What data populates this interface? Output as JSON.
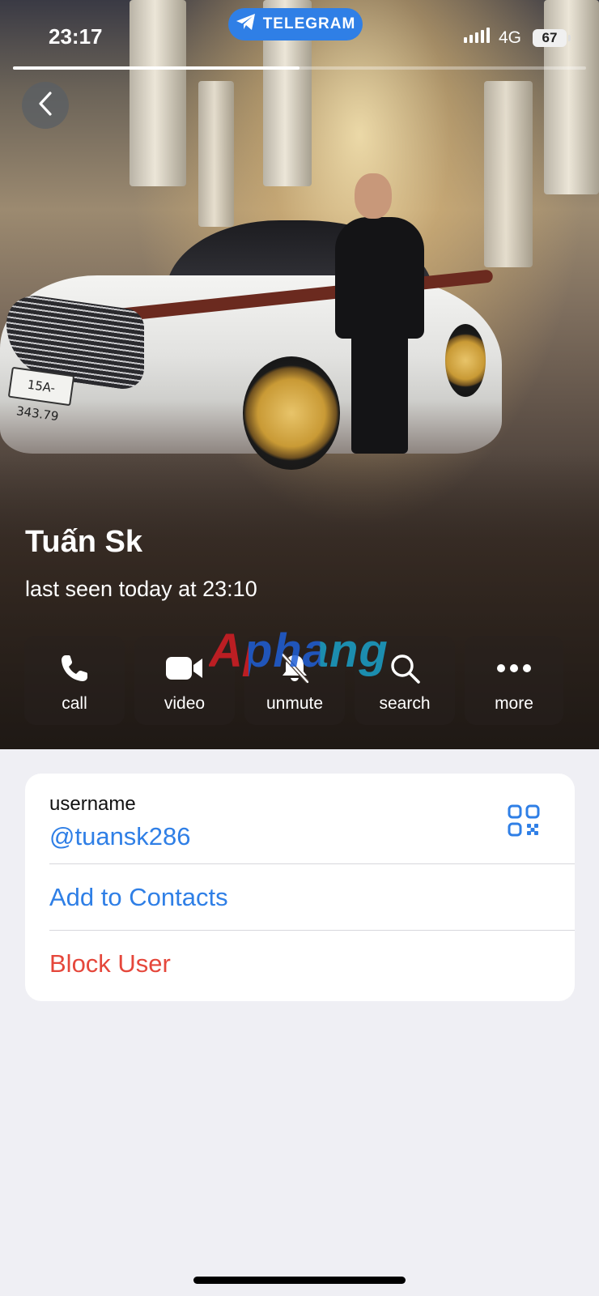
{
  "status_bar": {
    "time": "23:17",
    "app_pill": "TELEGRAM",
    "network": "4G",
    "battery": "67",
    "story_progress_percent": 50
  },
  "header": {
    "back_icon": "chevron-left-icon"
  },
  "profile": {
    "name": "Tuấn Sk",
    "status": "last seen today at 23:10",
    "photo_plate_text": "15A-343.79"
  },
  "actions": [
    {
      "label": "call",
      "icon": "phone-icon"
    },
    {
      "label": "video",
      "icon": "video-camera-icon"
    },
    {
      "label": "unmute",
      "icon": "bell-slash-icon"
    },
    {
      "label": "search",
      "icon": "search-icon"
    },
    {
      "label": "more",
      "icon": "ellipsis-icon"
    }
  ],
  "watermark": "Aphang",
  "info": {
    "username_label": "username",
    "username_value": "@tuansk286",
    "add_contact": "Add to Contacts",
    "block_user": "Block User"
  },
  "colors": {
    "accent": "#2f7fe6",
    "destructive": "#e5473b",
    "background": "#efeff4"
  }
}
